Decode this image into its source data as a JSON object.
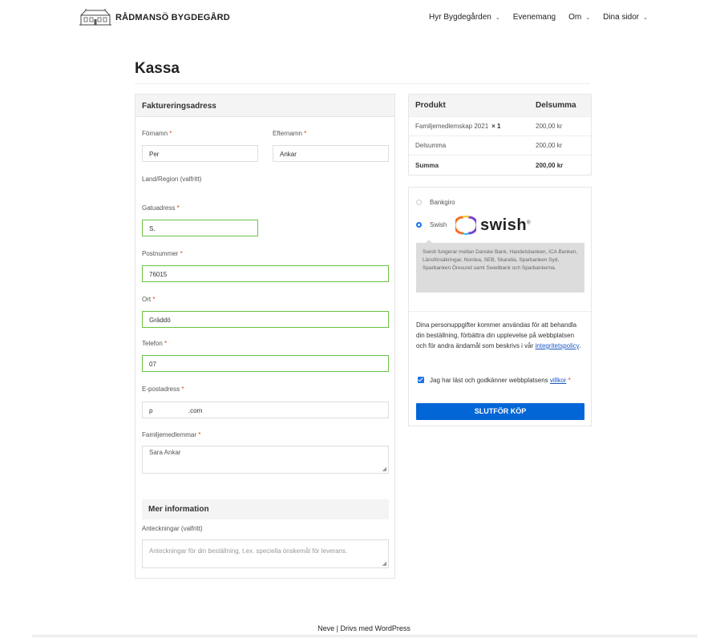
{
  "header": {
    "site_title": "RÅDMANSÖ BYGDEGÅRD",
    "nav": [
      {
        "label": "Hyr Bygdegården",
        "has_dropdown": true
      },
      {
        "label": "Evenemang",
        "has_dropdown": false
      },
      {
        "label": "Om",
        "has_dropdown": true
      },
      {
        "label": "Dina sidor",
        "has_dropdown": true
      }
    ]
  },
  "page": {
    "title": "Kassa"
  },
  "billing": {
    "heading": "Faktureringsadress",
    "first_name": {
      "label": "Förnamn",
      "value": "Per"
    },
    "last_name": {
      "label": "Efternamn",
      "value": "Ankar"
    },
    "country": {
      "label": "Land/Region (valfritt)"
    },
    "street": {
      "label": "Gatuadress",
      "value": "S."
    },
    "postcode": {
      "label": "Postnummer",
      "value": "76015"
    },
    "city": {
      "label": "Ort",
      "value": "Gräddö"
    },
    "phone": {
      "label": "Telefon",
      "value": "07"
    },
    "email": {
      "label": "E-postadress",
      "value": "p                    .com"
    },
    "members": {
      "label": "Familjemedlemmar",
      "value": "Sara Ankar"
    },
    "required_mark": "*"
  },
  "more_info": {
    "heading": "Mer information",
    "notes_label": "Anteckningar (valfritt)",
    "notes_placeholder": "Anteckningar för din beställning, t.ex. speciella önskemål för leverans."
  },
  "order": {
    "col_product": "Produkt",
    "col_subtotal": "Delsumma",
    "item_name": "Familjemedlemskap 2021",
    "item_qty": "× 1",
    "item_price": "200,00 kr",
    "subtotal_label": "Delsumma",
    "subtotal_value": "200,00 kr",
    "total_label": "Summa",
    "total_value": "200,00 kr"
  },
  "payment": {
    "methods": [
      {
        "label": "Bankgiro",
        "selected": false
      },
      {
        "label": "Swish",
        "selected": true
      }
    ],
    "swish_brand": "swish",
    "description": "Swish fungerar mellan Danske Bank, Handelsbanken, ICA Banken, Länsförsäkringar, Nordea, SEB, Skandia, Sparbanken Syd, Sparbanken Öresund samt Swedbank och Sparbankerna.",
    "privacy_text": "Dina personuppgifter kommer användas för att behandla din beställning, förbättra din upplevelse på webbplatsen och för andra ändamål som beskrivs i vår ",
    "privacy_link": "integritetspolicy",
    "privacy_end": ".",
    "terms_text": "Jag har läst och godkänner webbplatsens ",
    "terms_link": "villkor",
    "terms_required": "*",
    "terms_checked": true,
    "button_label": "SLUTFÖR KÖP",
    "accent_color": "#0366d6"
  },
  "footer": {
    "text": "Neve | Drivs med WordPress"
  }
}
